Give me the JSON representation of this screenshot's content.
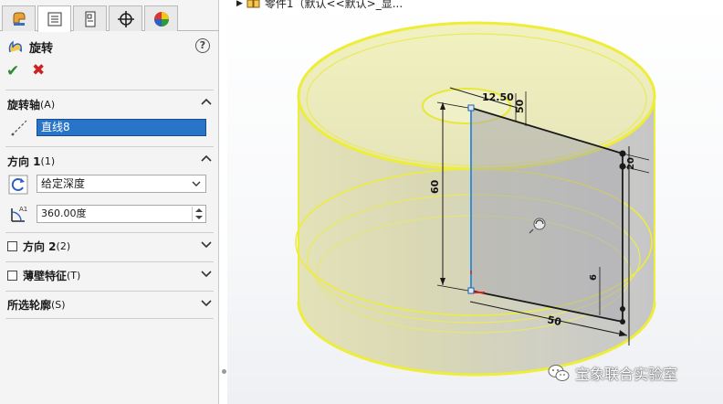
{
  "panel": {
    "title": "旋转",
    "help": "?",
    "ok": "✔",
    "cancel": "✖",
    "sections": {
      "axis": {
        "label": "旋转轴",
        "shortcut": "(A)",
        "value": "直线8"
      },
      "direction1": {
        "label": "方向 1",
        "shortcut": "(1)",
        "end_condition": "给定深度",
        "angle": "360.00度"
      },
      "direction2": {
        "label": "方向 2",
        "shortcut": "(2)",
        "checked": false
      },
      "thin_feature": {
        "label": "薄壁特征",
        "shortcut": "(T)",
        "checked": false
      },
      "selected_contours": {
        "label": "所选轮廓",
        "shortcut": "(S)"
      }
    }
  },
  "viewport": {
    "breadcrumb": "零件1（默认<<默认>_显...",
    "dimensions": {
      "top": "12.50",
      "right_top": "50",
      "height": "60",
      "right_small": "20",
      "bottom_small": "6",
      "bottom": "50"
    }
  },
  "watermark": {
    "text": "宝象联合实验室"
  },
  "colors": {
    "selection_blue": "#2874c9",
    "edge_yellow": "#f0f030",
    "sketch_blue": "#3a8fd6",
    "ok_green": "#2e8b2e",
    "cancel_red": "#cc2222"
  }
}
